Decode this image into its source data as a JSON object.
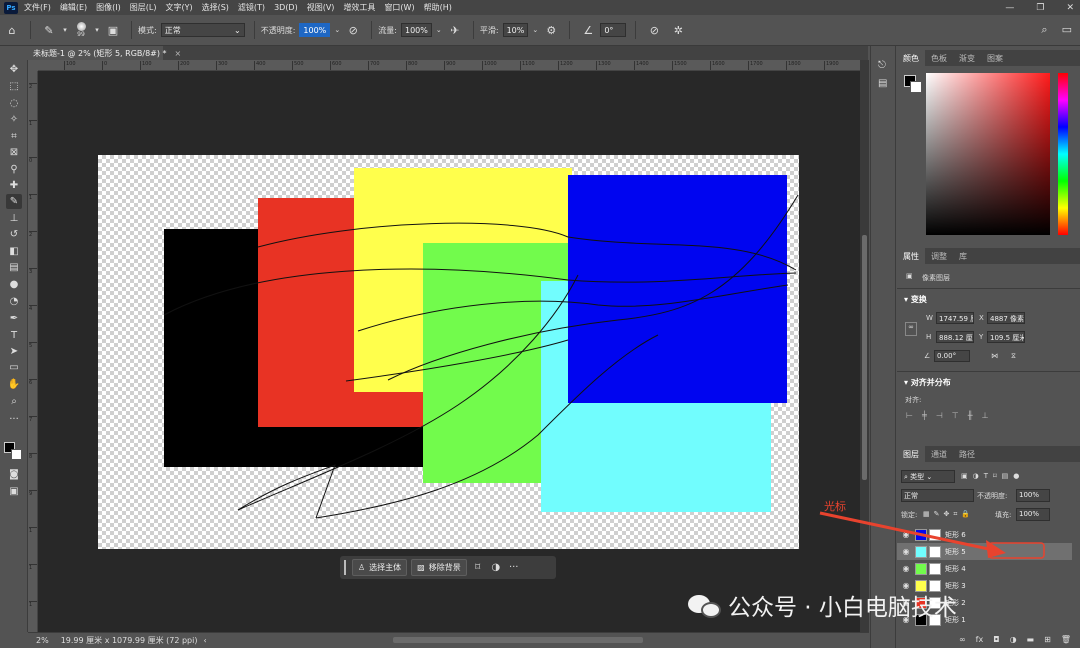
{
  "menubar": {
    "logo": "Ps",
    "items": [
      "文件(F)",
      "编辑(E)",
      "图像(I)",
      "图层(L)",
      "文字(Y)",
      "选择(S)",
      "滤镜(T)",
      "3D(D)",
      "视图(V)",
      "增效工具",
      "窗口(W)",
      "帮助(H)"
    ],
    "window_controls": [
      "—",
      "❐",
      "✕"
    ]
  },
  "options": {
    "brush_size": "99",
    "mode_label": "模式:",
    "mode_value": "正常",
    "opacity_label": "不透明度:",
    "opacity_value": "100%",
    "flow_label": "流量:",
    "flow_value": "100%",
    "smooth_label": "平滑:",
    "smooth_value": "10%",
    "angle_value": "0°"
  },
  "document": {
    "tab_title": "未标题-1 @ 2% (矩形 5, RGB/8#) *",
    "tab_close": "×"
  },
  "rulers": {
    "h_ticks": [
      "100",
      "0",
      "100",
      "200",
      "300",
      "400",
      "500",
      "600",
      "700",
      "800",
      "900",
      "1000",
      "1100",
      "1200",
      "1300",
      "1400",
      "1500",
      "1600",
      "1700",
      "1800",
      "1900"
    ],
    "v_ticks": [
      "2",
      "1",
      "0",
      "1",
      "2",
      "3",
      "4",
      "5",
      "6",
      "7",
      "8",
      "9",
      "1",
      "1",
      "1"
    ]
  },
  "canvas": {
    "colors": {
      "black": "#000000",
      "red": "#e83324",
      "yellow": "#ffff4c",
      "green": "#72fb4c",
      "cyan": "#71fdfe",
      "blue": "#0005f0"
    }
  },
  "taskbar": {
    "select_subject": "选择主体",
    "remove_bg": "移除背景",
    "more": "···"
  },
  "status": {
    "zoom": "2%",
    "doc_size": "19.99 厘米 x 1079.99 厘米 (72 ppi)",
    "arrow": "‹"
  },
  "color_panel": {
    "tabs": [
      "颜色",
      "色板",
      "渐变",
      "图案"
    ]
  },
  "properties_panel": {
    "tabs": [
      "属性",
      "调整",
      "库"
    ],
    "layer_type": "像素图层",
    "transform_title": "变换",
    "w_label": "W",
    "w_value": "1747.59 厘",
    "x_label": "X",
    "x_value": "4887 像素",
    "h_label": "H",
    "h_value": "888.12 厘",
    "y_label": "Y",
    "y_value": "109.5 厘米",
    "angle_value": "0.00°",
    "align_title": "对齐并分布",
    "align_label": "对齐:"
  },
  "layers_panel": {
    "tabs": [
      "图层",
      "通道",
      "路径"
    ],
    "filter_label": "类型",
    "blend_mode": "正常",
    "opacity_label": "不透明度:",
    "opacity_value": "100%",
    "lock_label": "锁定:",
    "fill_label": "填充:",
    "fill_value": "100%",
    "layers": [
      {
        "name": "矩形 6",
        "color": "#0005f0"
      },
      {
        "name": "矩形 5",
        "color": "#71fdfe"
      },
      {
        "name": "矩形 4",
        "color": "#72fb4c"
      },
      {
        "name": "矩形 3",
        "color": "#ffff4c"
      },
      {
        "name": "矩形 2",
        "color": "#e83324"
      },
      {
        "name": "矩形 1",
        "color": "#000000"
      }
    ]
  },
  "annotation": {
    "label": "光标",
    "color": "#e8432e"
  },
  "watermark": {
    "text": "公众号 · 小白电脑技术"
  }
}
